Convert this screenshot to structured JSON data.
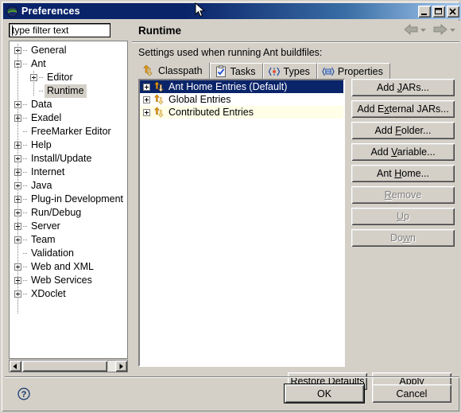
{
  "window": {
    "title": "Preferences",
    "icon": "eclipse-icon",
    "controls": [
      {
        "name": "minimize-button",
        "glyph": "minimize"
      },
      {
        "name": "maximize-button",
        "glyph": "maximize"
      },
      {
        "name": "close-button",
        "glyph": "close"
      }
    ]
  },
  "sidebar": {
    "filter": {
      "value": "type filter text",
      "placeholder": "type filter text"
    },
    "items": [
      {
        "label": "General",
        "indent": 0,
        "expander": "plus"
      },
      {
        "label": "Ant",
        "indent": 0,
        "expander": "minus"
      },
      {
        "label": "Editor",
        "indent": 1,
        "expander": "plus"
      },
      {
        "label": "Runtime",
        "indent": 1,
        "expander": "none",
        "selected": true
      },
      {
        "label": "Data",
        "indent": 0,
        "expander": "plus"
      },
      {
        "label": "Exadel",
        "indent": 0,
        "expander": "plus"
      },
      {
        "label": "FreeMarker Editor",
        "indent": 0,
        "expander": "none"
      },
      {
        "label": "Help",
        "indent": 0,
        "expander": "plus"
      },
      {
        "label": "Install/Update",
        "indent": 0,
        "expander": "plus"
      },
      {
        "label": "Internet",
        "indent": 0,
        "expander": "plus"
      },
      {
        "label": "Java",
        "indent": 0,
        "expander": "plus"
      },
      {
        "label": "Plug-in Development",
        "indent": 0,
        "expander": "plus"
      },
      {
        "label": "Run/Debug",
        "indent": 0,
        "expander": "plus"
      },
      {
        "label": "Server",
        "indent": 0,
        "expander": "plus"
      },
      {
        "label": "Team",
        "indent": 0,
        "expander": "plus"
      },
      {
        "label": "Validation",
        "indent": 0,
        "expander": "none"
      },
      {
        "label": "Web and XML",
        "indent": 0,
        "expander": "plus"
      },
      {
        "label": "Web Services",
        "indent": 0,
        "expander": "plus"
      },
      {
        "label": "XDoclet",
        "indent": 0,
        "expander": "plus"
      }
    ],
    "scrollbar": {
      "left_arrow": "left-arrow-icon",
      "right_arrow": "right-arrow-icon"
    }
  },
  "main": {
    "title": "Runtime",
    "description": "Settings used when running Ant buildfiles:",
    "nav": {
      "back": "back-arrow-icon",
      "back_menu": "chevron-down-icon",
      "forward": "forward-arrow-icon",
      "forward_menu": "chevron-down-icon"
    },
    "tabs": [
      {
        "label": "Classpath",
        "icon": "ant-classpath-icon",
        "active": true
      },
      {
        "label": "Tasks",
        "icon": "tasks-clipboard-icon",
        "active": false
      },
      {
        "label": "Types",
        "icon": "types-icon",
        "active": false
      },
      {
        "label": "Properties",
        "icon": "properties-icon",
        "active": false
      }
    ],
    "classpath_entries": [
      {
        "label": "Ant Home Entries (Default)",
        "icon": "ant-home-icon",
        "selected": true,
        "alt": false
      },
      {
        "label": "Global Entries",
        "icon": "global-entries-icon",
        "selected": false,
        "alt": false
      },
      {
        "label": "Contributed Entries",
        "icon": "contributed-entries-icon",
        "selected": false,
        "alt": true
      }
    ],
    "buttons": [
      {
        "label": "Add JARs...",
        "mnemonic": "J",
        "enabled": true
      },
      {
        "label": "Add External JARs...",
        "mnemonic": "x",
        "enabled": true
      },
      {
        "label": "Add Folder...",
        "mnemonic": "F",
        "enabled": true
      },
      {
        "label": "Add Variable...",
        "mnemonic": "V",
        "enabled": true
      },
      {
        "label": "Ant Home...",
        "mnemonic": "H",
        "enabled": true
      },
      {
        "label": "Remove",
        "mnemonic": "R",
        "enabled": false
      },
      {
        "label": "Up",
        "mnemonic": "U",
        "enabled": false
      },
      {
        "label": "Down",
        "mnemonic": "w",
        "enabled": false
      }
    ],
    "apply_row": [
      {
        "label": "Restore Defaults",
        "mnemonic": "D"
      },
      {
        "label": "Apply",
        "mnemonic": "A"
      }
    ]
  },
  "footer": {
    "help_icon": "help-question-icon",
    "buttons": [
      {
        "label": "OK",
        "default": true
      },
      {
        "label": "Cancel",
        "default": false
      }
    ]
  },
  "colors": {
    "titlebar_start": "#0a246a",
    "titlebar_end": "#a6caf0",
    "dialog_face": "#d4d0c8",
    "selection": "#0a246a",
    "alt_row": "#ffffe8",
    "icon_gold": "#f5a623",
    "disabled_text": "#808080"
  }
}
